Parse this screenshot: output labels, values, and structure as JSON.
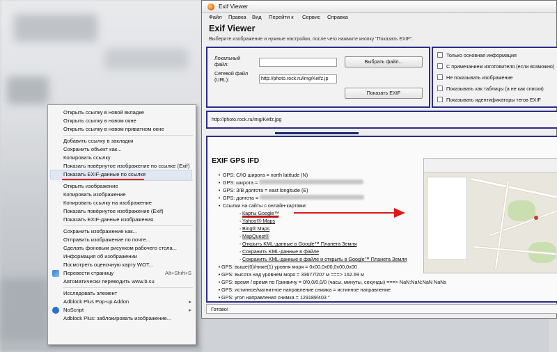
{
  "window": {
    "title": "Exif Viewer",
    "menu": [
      "Файл",
      "Правка",
      "Вид",
      "Перейти к",
      "Сервис",
      "Справка"
    ],
    "app_title": "Exif Viewer",
    "description": "Выберите изображение и нужные настройки, после чего нажмите кнопку \"Показать EXIF\"."
  },
  "form": {
    "local_label_1": "Локальный",
    "local_label_2": "файл:",
    "local_value": "",
    "network_label_1": "Сетевой файл",
    "network_label_2": "(URL):",
    "network_value": "http://photo.rock.ru/img/Keifz.jp",
    "choose_button": "Выбрать файл...",
    "show_button": "Показать EXIF"
  },
  "options": [
    "Только основная информация",
    "С примечанием изготовителя (если возможно)",
    "Не показывать изображение",
    "Показывать как таблицы (а не как списки)",
    "Показывать идентификаторы тегов EXIF"
  ],
  "url_panel": {
    "url": "http://photo.rock.ru/img/Keifz.jpg"
  },
  "gps": {
    "heading": "EXIF GPS IFD",
    "lines": [
      {
        "prefix": "GPS: ",
        "text": "С/Ю широта = north latitude (N)",
        "blur": 0
      },
      {
        "prefix": "GPS: ",
        "text": "широта = ",
        "blur": 150
      },
      {
        "prefix": "GPS: ",
        "text": "З/В долгота = east longitude (E)",
        "blur": 0
      },
      {
        "prefix": "GPS: ",
        "text": "долгота = ",
        "blur": 150
      },
      {
        "prefix": "",
        "text": "Ссылки на сайты с онлайн-картами:",
        "blur": 0
      }
    ],
    "links": [
      "Карты Google™",
      "Yahoo!® Maps",
      "Bing® Maps",
      "MapQuest®",
      "Открыть KML-данные в Google™ Планета Земля",
      "Сохранить KML-данные в файле",
      "Сохранить KML-данные в файле и открыть в Google™ Планета Земля"
    ],
    "tail": [
      "GPS: выше(0)/ниже(1) уровня моря = 0x00,0x00,0x00,0x00",
      "GPS: высота над уровнем моря = 33677/207 м ===> 162.69 м",
      "GPS: время / время по Гринвичу = 0/0,0/0,0/0 (часы, минуты, секунды) ===> NaN:NaN:NaN NaNs",
      "GPS: истинное/магнитное направление снимка = истинное направление",
      "GPS: угол направления снимка = 129189/403 °"
    ]
  },
  "status": "Готово!",
  "context_menu": {
    "items": [
      {
        "label": "Открыть ссылку в новой вкладке"
      },
      {
        "label": "Открыть ссылку в новом окне"
      },
      {
        "label": "Открыть ссылку в новом приватном окне"
      },
      {
        "sep": true
      },
      {
        "label": "Добавить ссылку в закладки"
      },
      {
        "label": "Сохранить объект как..."
      },
      {
        "label": "Копировать ссылку"
      },
      {
        "label": "Показать повёрнутое изображение по ссылке (Exif)"
      },
      {
        "label": "Показать EXIF-данные по ссылке",
        "highlight": true
      },
      {
        "sep": true
      },
      {
        "label": "Открыть изображение"
      },
      {
        "label": "Копировать изображение"
      },
      {
        "label": "Копировать ссылку на изображение"
      },
      {
        "label": "Показать повёрнутое изображение (Exif)"
      },
      {
        "label": "Показать EXIF-данные изображения"
      },
      {
        "sep": true
      },
      {
        "label": "Сохранить изображение как..."
      },
      {
        "label": "Отправить изображение по почте..."
      },
      {
        "label": "Сделать фоновым рисунком рабочего стола..."
      },
      {
        "label": "Информация об изображении"
      },
      {
        "label": "Посмотреть оценочную карту WOT..."
      },
      {
        "label": "Перевести страницу",
        "shortcut": "Alt+Shift+S",
        "icon": "translate"
      },
      {
        "label": "Автоматически переводить www.b.su"
      },
      {
        "sep": true
      },
      {
        "label": "Исследовать элемент"
      },
      {
        "label": "Adblock Plus Pop-up Addon",
        "submenu": true
      },
      {
        "label": "NoScript",
        "submenu": true,
        "icon": "noscript"
      },
      {
        "label": "Adblock Plus: заблокировать изображение..."
      }
    ]
  },
  "colors": {
    "panel_border": "#2b2b8a",
    "arrow": "#e01818",
    "highlight": "#e2e8f3"
  }
}
